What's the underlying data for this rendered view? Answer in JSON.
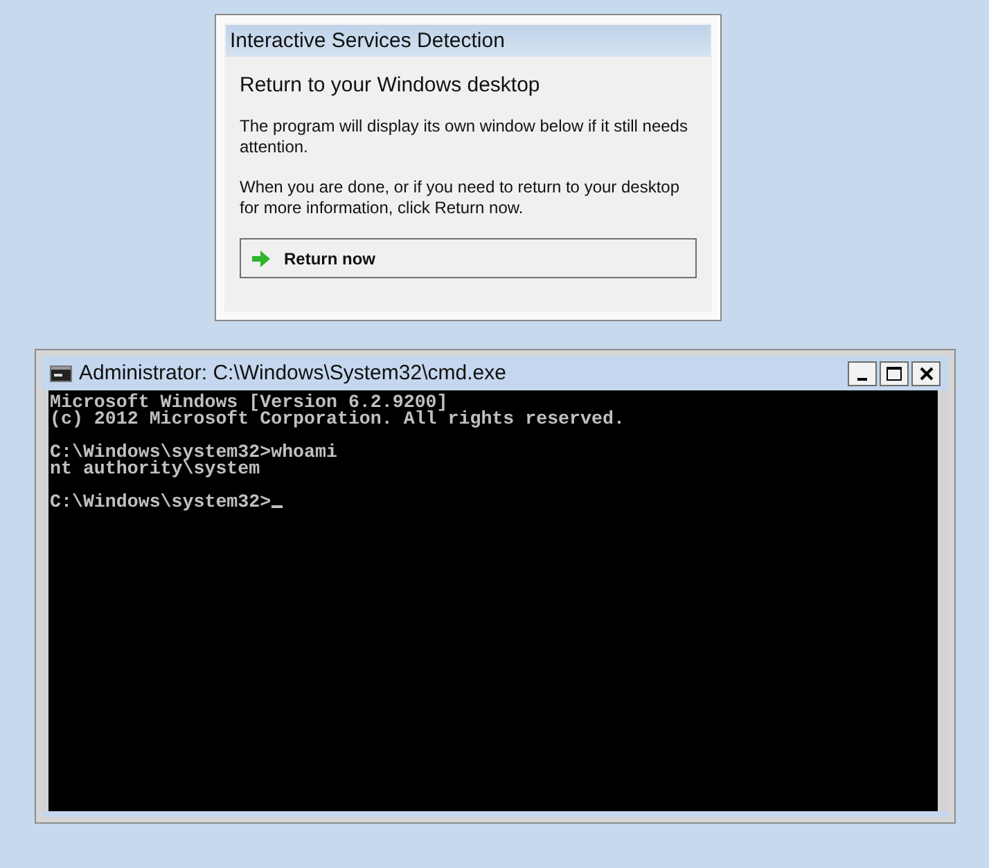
{
  "dialog": {
    "title": "Interactive Services Detection",
    "heading": "Return to your Windows desktop",
    "paragraphs": [
      "The program will display its own window below if it still needs attention.",
      "When you are done, or if you need to return to your desktop for more information, click Return now."
    ],
    "button": "Return now"
  },
  "console_window": {
    "title": "Administrator: C:\\Windows\\System32\\cmd.exe",
    "blocks": [
      [
        "Microsoft Windows [Version 6.2.9200]",
        "(c) 2012 Microsoft Corporation. All rights reserved."
      ],
      [
        "C:\\Windows\\system32>whoami",
        "nt authority\\system"
      ],
      [
        "C:\\Windows\\system32>"
      ]
    ],
    "cursor": true
  }
}
